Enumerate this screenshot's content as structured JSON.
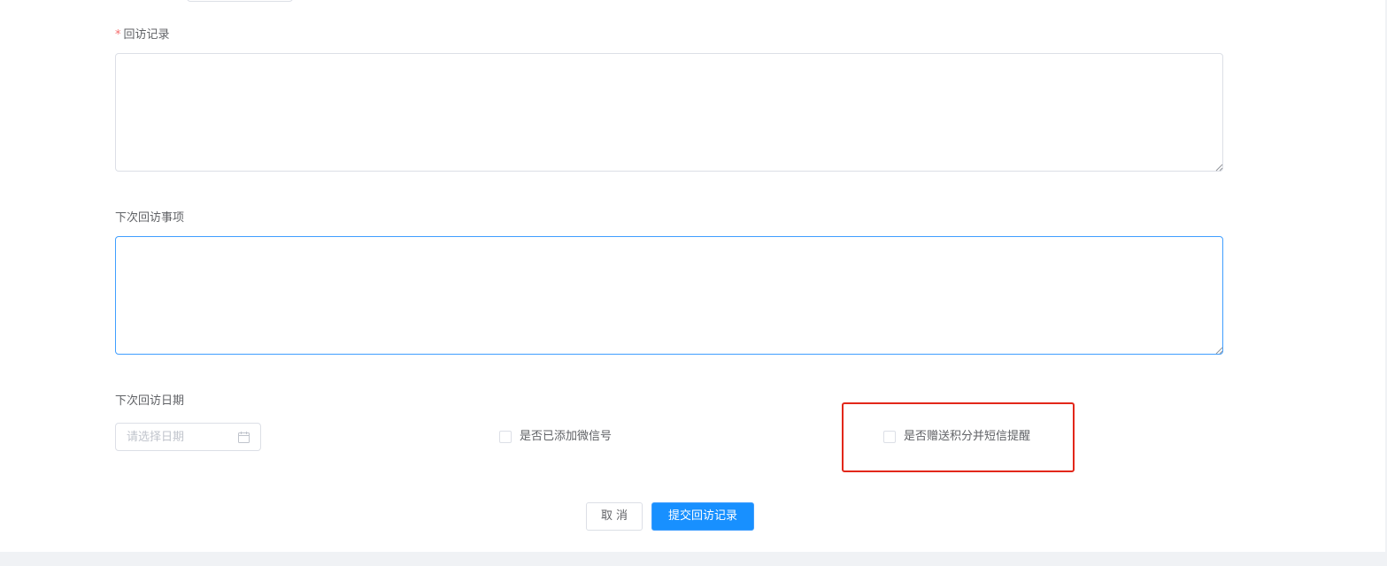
{
  "form": {
    "visit_record": {
      "required_mark": "*",
      "label": "回访记录",
      "value": ""
    },
    "next_visit_items": {
      "label": "下次回访事项",
      "value": ""
    },
    "next_visit_date": {
      "label": "下次回访日期",
      "placeholder": "请选择日期",
      "icon": "calendar-icon"
    },
    "wechat_added": {
      "label": "是否已添加微信号",
      "checked": false
    },
    "points_sms": {
      "label": "是否赠送积分并短信提醒",
      "checked": false
    }
  },
  "actions": {
    "cancel_label": "取消",
    "submit_label": "提交回访记录"
  },
  "colors": {
    "primary": "#1890ff",
    "focus_border": "#409eff",
    "required": "#f56c6c",
    "highlight_box": "#e2271a",
    "footer_bg": "#f0f2f5"
  }
}
